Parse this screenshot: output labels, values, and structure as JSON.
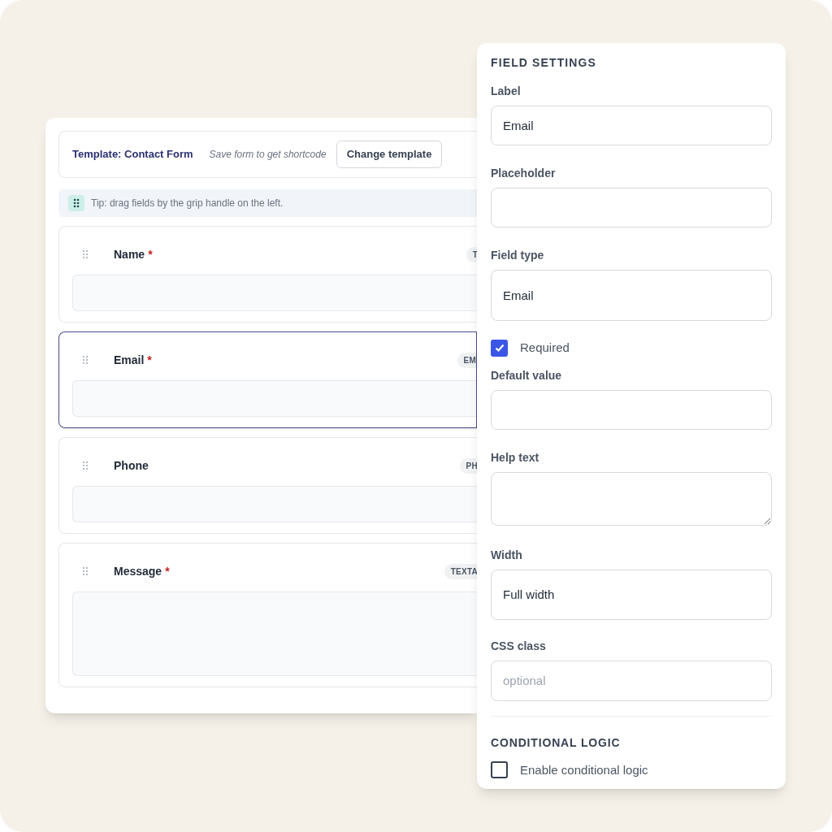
{
  "builder": {
    "template_label": "Template: Contact Form",
    "shortcode_note": "Save form to get shortcode",
    "change_button": "Change template",
    "tip": "Tip: drag fields by the grip handle on the left.",
    "fields": [
      {
        "label": "Name",
        "required_mark": "*",
        "badge": "T",
        "selected": false,
        "kind": "input"
      },
      {
        "label": "Email",
        "required_mark": "*",
        "badge": "EM",
        "selected": true,
        "kind": "input"
      },
      {
        "label": "Phone",
        "badge": "PH",
        "selected": false,
        "kind": "input"
      },
      {
        "label": "Message",
        "required_mark": "*",
        "badge": "TEXTA",
        "selected": false,
        "kind": "textarea"
      }
    ]
  },
  "settings": {
    "title": "FIELD SETTINGS",
    "items": [
      {
        "kind": "input",
        "label": "Label",
        "value": "Email"
      },
      {
        "kind": "input",
        "label": "Placeholder"
      },
      {
        "kind": "select",
        "label": "Field type",
        "value": "Email"
      },
      {
        "kind": "checkbox",
        "label": "Required",
        "checked": true
      },
      {
        "kind": "input",
        "label": "Default value"
      },
      {
        "kind": "textarea",
        "label": "Help text"
      },
      {
        "kind": "select",
        "label": "Width",
        "value": "Full width"
      },
      {
        "kind": "input",
        "label": "CSS class",
        "placeholder": "optional"
      },
      {
        "kind": "divider"
      },
      {
        "kind": "heading",
        "label": "CONDITIONAL LOGIC"
      },
      {
        "kind": "checkbox",
        "label": "Enable conditional logic",
        "checked": false
      }
    ]
  }
}
